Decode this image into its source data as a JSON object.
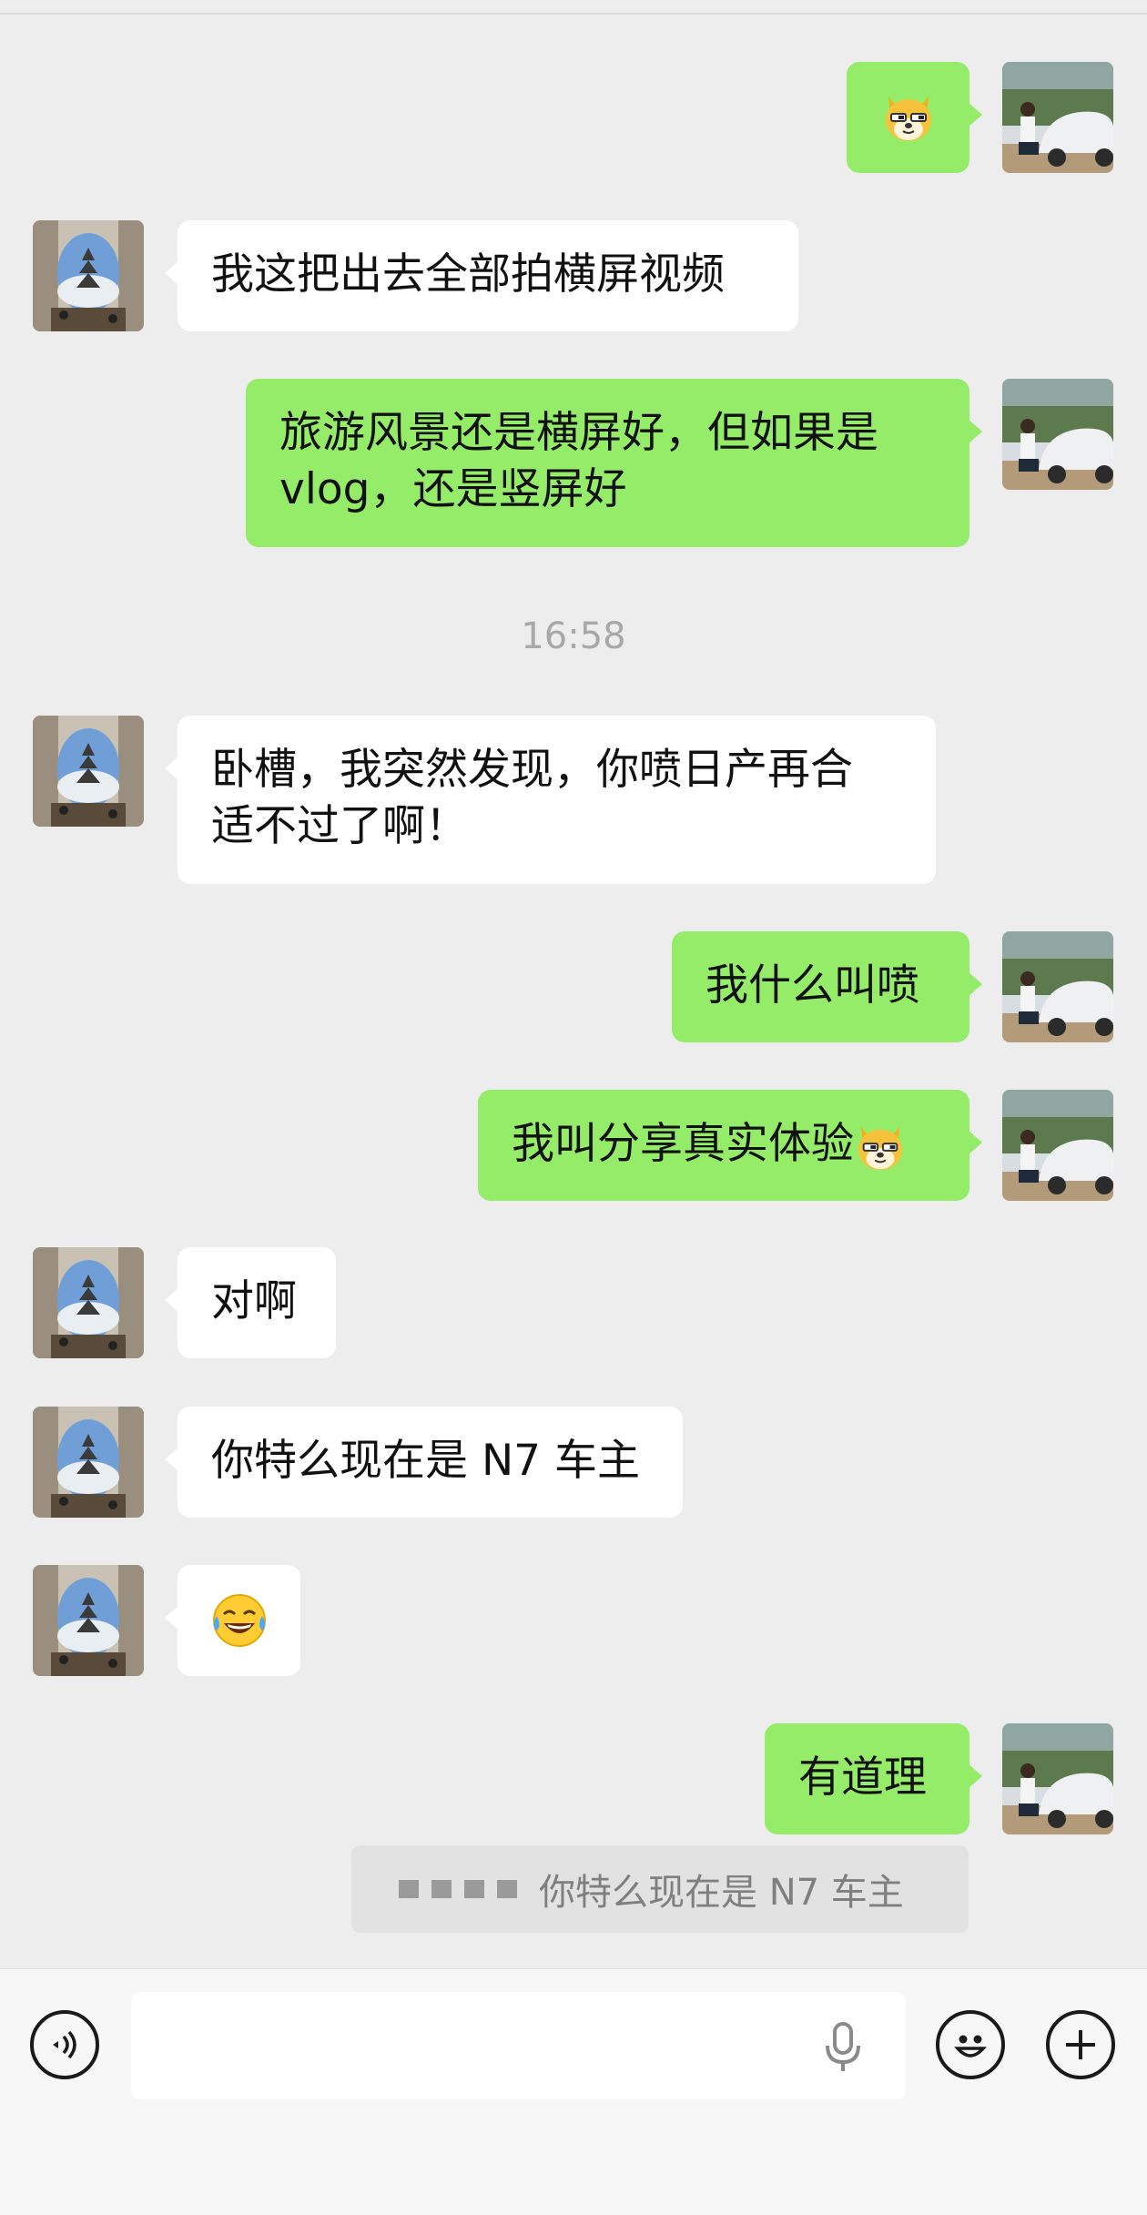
{
  "conversation": {
    "messages": [
      {
        "side": "right",
        "text": "",
        "emoji": "doge-emoji"
      },
      {
        "side": "left",
        "text": "我这把出去全部拍横屏视频"
      },
      {
        "side": "right",
        "lines": [
          "旅游风景还是横屏好，但如果是",
          "vlog，还是竖屏好"
        ]
      },
      {
        "side": "left",
        "lines": [
          "卧槽，我突然发现，你喷日产再合",
          "适不过了啊！"
        ]
      },
      {
        "side": "right",
        "text": "我什么叫喷"
      },
      {
        "side": "right",
        "text": "我叫分享真实体验",
        "emoji": "doge-emoji"
      },
      {
        "side": "left",
        "text": "对啊"
      },
      {
        "side": "left",
        "text": "你特么现在是 N7 车主"
      },
      {
        "side": "left",
        "text": "",
        "emoji": "tears-of-joy-emoji"
      },
      {
        "side": "right",
        "text": "有道理"
      }
    ],
    "timestamp": "16:58",
    "quote": {
      "text": "你特么现在是 N7 车主"
    }
  },
  "input_bar": {
    "value": "",
    "placeholder": ""
  },
  "colors": {
    "outgoing": "#95ec69",
    "incoming": "#ffffff",
    "background": "#ededed"
  }
}
